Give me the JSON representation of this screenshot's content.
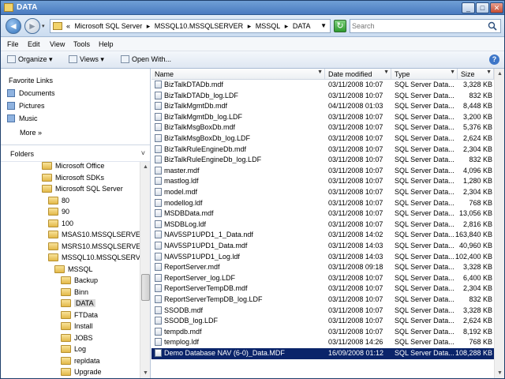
{
  "window": {
    "title": "DATA",
    "minimize_label": "_",
    "maximize_label": "□",
    "close_label": "✕"
  },
  "address": {
    "back_glyph": "◄",
    "forward_glyph": "►",
    "history_glyph": "▾",
    "crumbs": [
      "«",
      "Microsoft SQL Server",
      "▸",
      "MSSQL10.MSSQLSERVER",
      "▸",
      "MSSQL",
      "▸",
      "DATA"
    ],
    "dropdown_glyph": "▼",
    "refresh_glyph": "↻",
    "search_placeholder": "Search"
  },
  "menu": [
    "File",
    "Edit",
    "View",
    "Tools",
    "Help"
  ],
  "toolbar": {
    "organize": "Organize  ▾",
    "views": "Views  ▾",
    "open_with": "Open With...",
    "help": "?"
  },
  "favorites": {
    "header": "Favorite Links",
    "items": [
      "Documents",
      "Pictures",
      "Music"
    ],
    "more": "More  »"
  },
  "folders": {
    "header": "Folders",
    "chevron": "˅",
    "tree": [
      {
        "label": "Microsoft Office",
        "indent": 0
      },
      {
        "label": "Microsoft SDKs",
        "indent": 0
      },
      {
        "label": "Microsoft SQL Server",
        "indent": 0
      },
      {
        "label": "80",
        "indent": 1
      },
      {
        "label": "90",
        "indent": 1
      },
      {
        "label": "100",
        "indent": 1
      },
      {
        "label": "MSAS10.MSSQLSERVER",
        "indent": 1
      },
      {
        "label": "MSRS10.MSSQLSERVER",
        "indent": 1
      },
      {
        "label": "MSSQL10.MSSQLSERVER",
        "indent": 1
      },
      {
        "label": "MSSQL",
        "indent": 2
      },
      {
        "label": "Backup",
        "indent": 3
      },
      {
        "label": "Binn",
        "indent": 3
      },
      {
        "label": "DATA",
        "indent": 3,
        "selected": true
      },
      {
        "label": "FTData",
        "indent": 3
      },
      {
        "label": "Install",
        "indent": 3
      },
      {
        "label": "JOBS",
        "indent": 3
      },
      {
        "label": "Log",
        "indent": 3
      },
      {
        "label": "repldata",
        "indent": 3
      },
      {
        "label": "Upgrade",
        "indent": 3
      }
    ]
  },
  "columns": {
    "name": "Name",
    "date": "Date modified",
    "type": "Type",
    "size": "Size"
  },
  "files": [
    {
      "name": "BizTalkDTADb.mdf",
      "date": "03/11/2008 10:07",
      "type": "SQL Server Data...",
      "size": "3,328 KB"
    },
    {
      "name": "BizTalkDTADb_log.LDF",
      "date": "03/11/2008 10:07",
      "type": "SQL Server Data...",
      "size": "832 KB"
    },
    {
      "name": "BizTalkMgmtDb.mdf",
      "date": "04/11/2008 01:03",
      "type": "SQL Server Data...",
      "size": "8,448 KB"
    },
    {
      "name": "BizTalkMgmtDb_log.LDF",
      "date": "03/11/2008 10:07",
      "type": "SQL Server Data...",
      "size": "3,200 KB"
    },
    {
      "name": "BizTalkMsgBoxDb.mdf",
      "date": "03/11/2008 10:07",
      "type": "SQL Server Data...",
      "size": "5,376 KB"
    },
    {
      "name": "BizTalkMsgBoxDb_log.LDF",
      "date": "03/11/2008 10:07",
      "type": "SQL Server Data...",
      "size": "2,624 KB"
    },
    {
      "name": "BizTalkRuleEngineDb.mdf",
      "date": "03/11/2008 10:07",
      "type": "SQL Server Data...",
      "size": "2,304 KB"
    },
    {
      "name": "BizTalkRuleEngineDb_log.LDF",
      "date": "03/11/2008 10:07",
      "type": "SQL Server Data...",
      "size": "832 KB"
    },
    {
      "name": "master.mdf",
      "date": "03/11/2008 10:07",
      "type": "SQL Server Data...",
      "size": "4,096 KB"
    },
    {
      "name": "mastlog.ldf",
      "date": "03/11/2008 10:07",
      "type": "SQL Server Data...",
      "size": "1,280 KB"
    },
    {
      "name": "model.mdf",
      "date": "03/11/2008 10:07",
      "type": "SQL Server Data...",
      "size": "2,304 KB"
    },
    {
      "name": "modellog.ldf",
      "date": "03/11/2008 10:07",
      "type": "SQL Server Data...",
      "size": "768 KB"
    },
    {
      "name": "MSDBData.mdf",
      "date": "03/11/2008 10:07",
      "type": "SQL Server Data...",
      "size": "13,056 KB"
    },
    {
      "name": "MSDBLog.ldf",
      "date": "03/11/2008 10:07",
      "type": "SQL Server Data...",
      "size": "2,816 KB"
    },
    {
      "name": "NAV5SP1UPD1_1_Data.ndf",
      "date": "03/11/2008 14:02",
      "type": "SQL Server Data...",
      "size": "163,840 KB"
    },
    {
      "name": "NAV5SP1UPD1_Data.mdf",
      "date": "03/11/2008 14:03",
      "type": "SQL Server Data...",
      "size": "40,960 KB"
    },
    {
      "name": "NAV5SP1UPD1_Log.ldf",
      "date": "03/11/2008 14:03",
      "type": "SQL Server Data...",
      "size": "102,400 KB"
    },
    {
      "name": "ReportServer.mdf",
      "date": "03/11/2008 09:18",
      "type": "SQL Server Data...",
      "size": "3,328 KB"
    },
    {
      "name": "ReportServer_log.LDF",
      "date": "03/11/2008 10:07",
      "type": "SQL Server Data...",
      "size": "6,400 KB"
    },
    {
      "name": "ReportServerTempDB.mdf",
      "date": "03/11/2008 10:07",
      "type": "SQL Server Data...",
      "size": "2,304 KB"
    },
    {
      "name": "ReportServerTempDB_log.LDF",
      "date": "03/11/2008 10:07",
      "type": "SQL Server Data...",
      "size": "832 KB"
    },
    {
      "name": "SSODB.mdf",
      "date": "03/11/2008 10:07",
      "type": "SQL Server Data...",
      "size": "3,328 KB"
    },
    {
      "name": "SSODB_log.LDF",
      "date": "03/11/2008 10:07",
      "type": "SQL Server Data...",
      "size": "2,624 KB"
    },
    {
      "name": "tempdb.mdf",
      "date": "03/11/2008 10:07",
      "type": "SQL Server Data...",
      "size": "8,192 KB"
    },
    {
      "name": "templog.ldf",
      "date": "03/11/2008 14:26",
      "type": "SQL Server Data...",
      "size": "768 KB"
    },
    {
      "name": "Demo Database NAV (6-0)_Data.MDF",
      "date": "16/09/2008 01:12",
      "type": "SQL Server Data...",
      "size": "108,288 KB",
      "selected": true
    }
  ],
  "scroll": {
    "up_glyph": "▲",
    "down_glyph": "▼"
  },
  "colors": {
    "selection": "#0a246a",
    "titlebar": "#4a7bc0"
  }
}
